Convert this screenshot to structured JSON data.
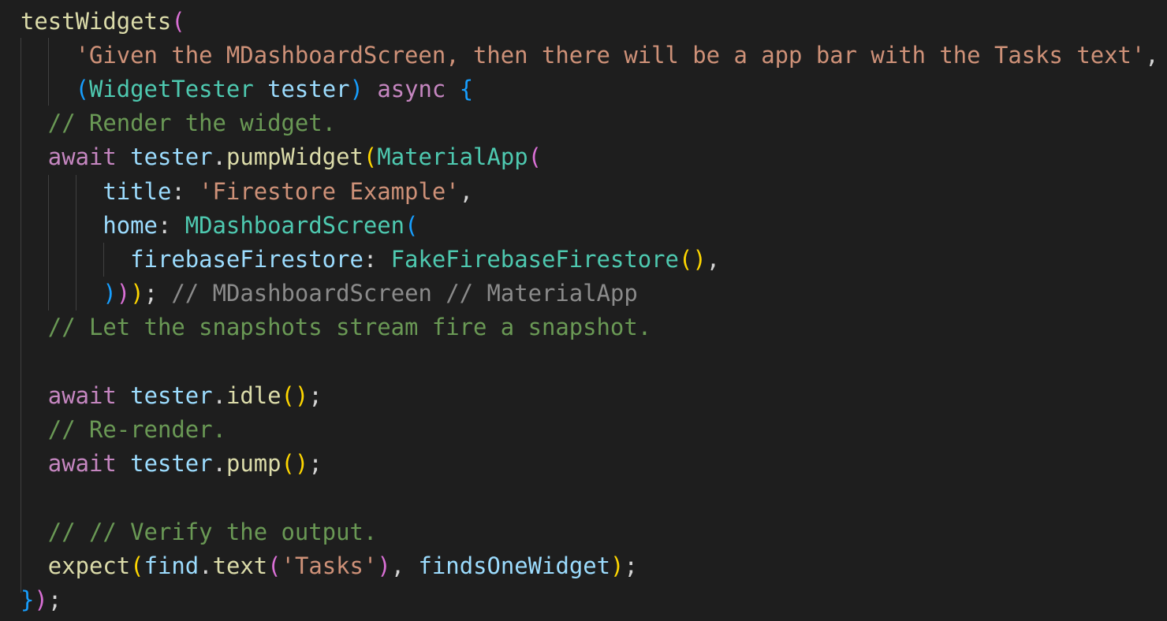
{
  "editor": {
    "colors": {
      "background": "#1e1e1e",
      "function": "#dcdcaa",
      "string": "#ce9178",
      "type": "#4ec9b0",
      "variable": "#9cdcfe",
      "keyword": "#c586c0",
      "comment": "#6a9955",
      "bracket_gold": "#ffd700",
      "bracket_orchid": "#da70d6",
      "bracket_blue": "#179fff"
    },
    "lines": [
      {
        "tokens": [
          {
            "text": "testWidgets",
            "kind": "fn"
          },
          {
            "text": "(",
            "kind": "b2"
          }
        ]
      },
      {
        "tokens": [
          {
            "text": "    ",
            "kind": "p"
          },
          {
            "text": "'Given the MDashboardScreen, then there will be a app bar with the Tasks text'",
            "kind": "str"
          },
          {
            "text": ",",
            "kind": "p"
          }
        ]
      },
      {
        "tokens": [
          {
            "text": "    ",
            "kind": "p"
          },
          {
            "text": "(",
            "kind": "b3"
          },
          {
            "text": "WidgetTester",
            "kind": "typ"
          },
          {
            "text": " ",
            "kind": "p"
          },
          {
            "text": "tester",
            "kind": "var"
          },
          {
            "text": ")",
            "kind": "b3"
          },
          {
            "text": " ",
            "kind": "p"
          },
          {
            "text": "async",
            "kind": "kw"
          },
          {
            "text": " ",
            "kind": "p"
          },
          {
            "text": "{",
            "kind": "b3"
          }
        ]
      },
      {
        "tokens": [
          {
            "text": "  ",
            "kind": "p"
          },
          {
            "text": "// Render the widget.",
            "kind": "cmt"
          }
        ]
      },
      {
        "tokens": [
          {
            "text": "  ",
            "kind": "p"
          },
          {
            "text": "await",
            "kind": "kw"
          },
          {
            "text": " ",
            "kind": "p"
          },
          {
            "text": "tester",
            "kind": "var"
          },
          {
            "text": ".",
            "kind": "p"
          },
          {
            "text": "pumpWidget",
            "kind": "fn"
          },
          {
            "text": "(",
            "kind": "b1"
          },
          {
            "text": "MaterialApp",
            "kind": "typ"
          },
          {
            "text": "(",
            "kind": "b2"
          }
        ]
      },
      {
        "tokens": [
          {
            "text": "      ",
            "kind": "p"
          },
          {
            "text": "title",
            "kind": "var"
          },
          {
            "text": ": ",
            "kind": "p"
          },
          {
            "text": "'Firestore Example'",
            "kind": "str"
          },
          {
            "text": ",",
            "kind": "p"
          }
        ]
      },
      {
        "tokens": [
          {
            "text": "      ",
            "kind": "p"
          },
          {
            "text": "home",
            "kind": "var"
          },
          {
            "text": ": ",
            "kind": "p"
          },
          {
            "text": "MDashboardScreen",
            "kind": "typ"
          },
          {
            "text": "(",
            "kind": "b3"
          }
        ]
      },
      {
        "tokens": [
          {
            "text": "        ",
            "kind": "p"
          },
          {
            "text": "firebaseFirestore",
            "kind": "var"
          },
          {
            "text": ": ",
            "kind": "p"
          },
          {
            "text": "FakeFirebaseFirestore",
            "kind": "typ"
          },
          {
            "text": "()",
            "kind": "b1"
          },
          {
            "text": ",",
            "kind": "p"
          }
        ]
      },
      {
        "tokens": [
          {
            "text": "      ",
            "kind": "p"
          },
          {
            "text": ")",
            "kind": "b3"
          },
          {
            "text": ")",
            "kind": "b2"
          },
          {
            "text": ")",
            "kind": "b1"
          },
          {
            "text": "; ",
            "kind": "p"
          },
          {
            "text": "// MDashboardScreen // MaterialApp",
            "kind": "inl"
          }
        ]
      },
      {
        "tokens": [
          {
            "text": "  ",
            "kind": "p"
          },
          {
            "text": "// Let the snapshots stream fire a snapshot.",
            "kind": "cmt"
          }
        ]
      },
      {
        "tokens": []
      },
      {
        "tokens": [
          {
            "text": "  ",
            "kind": "p"
          },
          {
            "text": "await",
            "kind": "kw"
          },
          {
            "text": " ",
            "kind": "p"
          },
          {
            "text": "tester",
            "kind": "var"
          },
          {
            "text": ".",
            "kind": "p"
          },
          {
            "text": "idle",
            "kind": "fn"
          },
          {
            "text": "()",
            "kind": "b1"
          },
          {
            "text": ";",
            "kind": "p"
          }
        ]
      },
      {
        "tokens": [
          {
            "text": "  ",
            "kind": "p"
          },
          {
            "text": "// Re-render.",
            "kind": "cmt"
          }
        ]
      },
      {
        "tokens": [
          {
            "text": "  ",
            "kind": "p"
          },
          {
            "text": "await",
            "kind": "kw"
          },
          {
            "text": " ",
            "kind": "p"
          },
          {
            "text": "tester",
            "kind": "var"
          },
          {
            "text": ".",
            "kind": "p"
          },
          {
            "text": "pump",
            "kind": "fn"
          },
          {
            "text": "()",
            "kind": "b1"
          },
          {
            "text": ";",
            "kind": "p"
          }
        ]
      },
      {
        "tokens": []
      },
      {
        "tokens": [
          {
            "text": "  ",
            "kind": "p"
          },
          {
            "text": "// // Verify the output.",
            "kind": "cmt"
          }
        ]
      },
      {
        "tokens": [
          {
            "text": "  ",
            "kind": "p"
          },
          {
            "text": "expect",
            "kind": "fn"
          },
          {
            "text": "(",
            "kind": "b1"
          },
          {
            "text": "find",
            "kind": "var"
          },
          {
            "text": ".",
            "kind": "p"
          },
          {
            "text": "text",
            "kind": "fn"
          },
          {
            "text": "(",
            "kind": "b2"
          },
          {
            "text": "'Tasks'",
            "kind": "str"
          },
          {
            "text": ")",
            "kind": "b2"
          },
          {
            "text": ", ",
            "kind": "p"
          },
          {
            "text": "findsOneWidget",
            "kind": "var"
          },
          {
            "text": ")",
            "kind": "b1"
          },
          {
            "text": ";",
            "kind": "p"
          }
        ]
      },
      {
        "tokens": [
          {
            "text": "}",
            "kind": "b3"
          },
          {
            "text": ")",
            "kind": "b2"
          },
          {
            "text": ";",
            "kind": "p"
          }
        ]
      }
    ]
  }
}
